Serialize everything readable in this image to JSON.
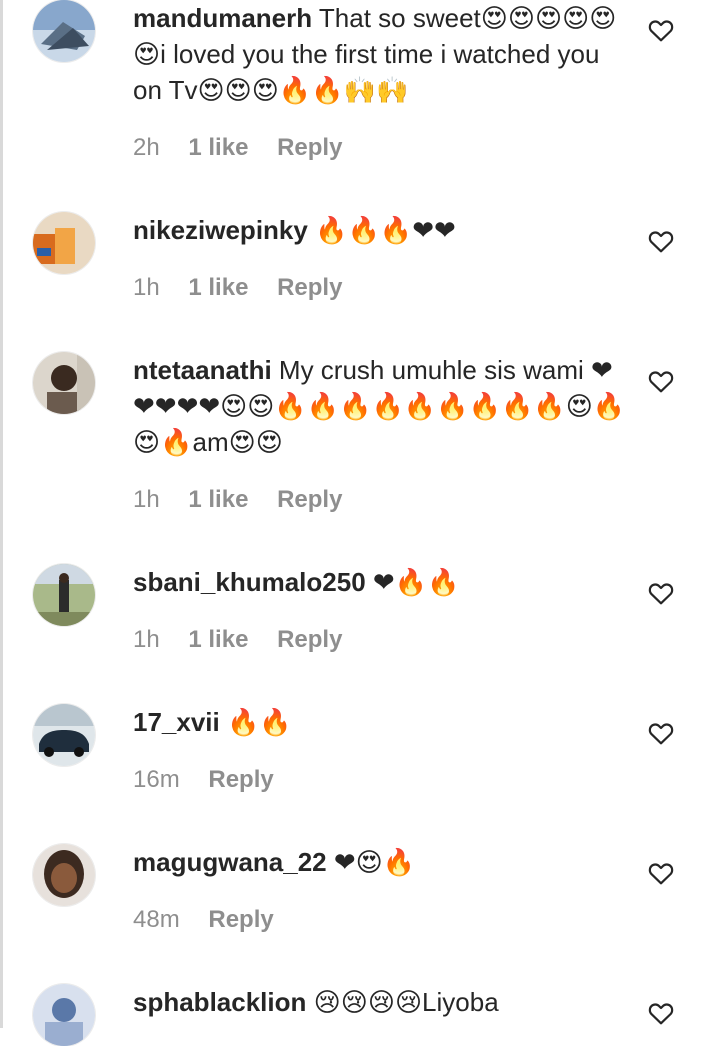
{
  "comments": [
    {
      "username": "mandumanerh",
      "text": "That so sweet😍😍😍😍😍😍i loved you the first time i watched you on Tv😍😍😍🔥🔥🙌🙌",
      "time": "2h",
      "likes": "1 like",
      "reply": "Reply",
      "avatar_color": "#6f8fb5"
    },
    {
      "username": "nikeziwepinky",
      "text": "🔥🔥🔥❤❤",
      "time": "1h",
      "likes": "1 like",
      "reply": "Reply",
      "avatar_color": "#b8773a"
    },
    {
      "username": "ntetaanathi",
      "text": "My crush umuhle sis wami ❤❤❤❤❤😍😍🔥🔥🔥🔥🔥🔥🔥🔥🔥😍🔥😍🔥am😍😍",
      "time": "1h",
      "likes": "1 like",
      "reply": "Reply",
      "avatar_color": "#8a6f55"
    },
    {
      "username": "sbani_khumalo250",
      "text": "❤🔥🔥",
      "time": "1h",
      "likes": "1 like",
      "reply": "Reply",
      "avatar_color": "#6f7d4c"
    },
    {
      "username": "17_xvii",
      "text": "🔥🔥",
      "time": "16m",
      "likes": "",
      "reply": "Reply",
      "avatar_color": "#2c3e52"
    },
    {
      "username": "magugwana_22",
      "text": "❤😍🔥",
      "time": "48m",
      "likes": "",
      "reply": "Reply",
      "avatar_color": "#4a3428"
    },
    {
      "username": "sphablacklion",
      "text": "😢😢😢😢Liyoba",
      "time": "",
      "likes": "",
      "reply": "",
      "avatar_color": "#7a8fb0"
    }
  ],
  "colors": {
    "text": "#262626",
    "meta": "#8e8e8e",
    "heart_outline": "#262626"
  },
  "icons": {
    "like": "heart-outline-icon"
  }
}
